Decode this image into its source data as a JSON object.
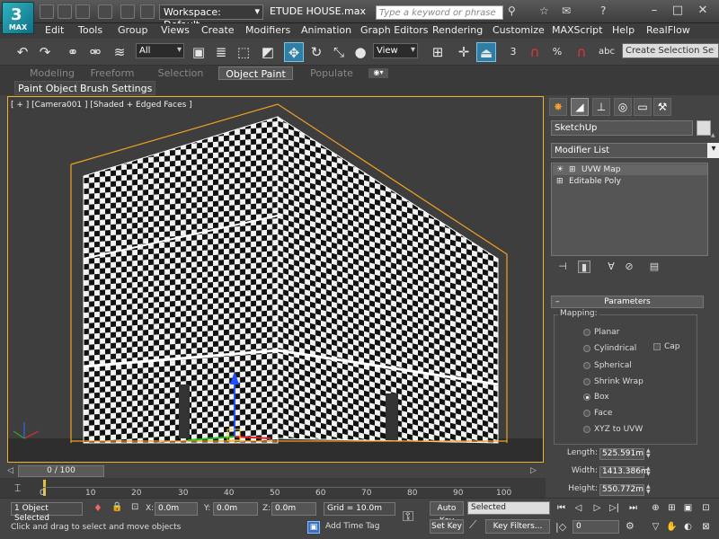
{
  "titlebar": {
    "logo_text": "MAX",
    "workspace": "Workspace: Default",
    "file_title": "ETUDE HOUSE.max",
    "search_placeholder": "Type a keyword or phrase"
  },
  "menu": [
    "Edit",
    "Tools",
    "Group",
    "Views",
    "Create",
    "Modifiers",
    "Animation",
    "Graph Editors",
    "Rendering",
    "Customize",
    "MAXScript",
    "Help",
    "RealFlow"
  ],
  "toolbar": {
    "selection_filter": "All",
    "ref_coord": "View",
    "named_selection_placeholder": "Create Selection Se"
  },
  "ribbon": {
    "tabs": [
      "Modeling",
      "Freeform",
      "Selection",
      "Object Paint",
      "Populate"
    ],
    "active_tab": "Object Paint",
    "subtabs": [
      "Paint Objects",
      "Brush Settings"
    ]
  },
  "viewport": {
    "label": "[ + ] [Camera001 ] [Shaded + Edged Faces ]"
  },
  "command_panel": {
    "object_name": "SketchUp",
    "modifier_list": "Modifier List",
    "stack": [
      "UVW Map",
      "Editable Poly"
    ],
    "rollout_title": "Parameters",
    "mapping_label": "Mapping:",
    "mapping_options": [
      "Planar",
      "Cylindrical",
      "Spherical",
      "Shrink Wrap",
      "Box",
      "Face",
      "XYZ to UVW"
    ],
    "mapping_selected": "Box",
    "cap_label": "Cap",
    "length_label": "Length:",
    "length_value": "525.591m",
    "width_label": "Width:",
    "width_value": "1413.386m",
    "height_label": "Height:",
    "height_value": "550.772m"
  },
  "timeline": {
    "slider": "0 / 100",
    "ticks": [
      "0",
      "10",
      "20",
      "30",
      "40",
      "50",
      "60",
      "70",
      "80",
      "90",
      "100"
    ]
  },
  "status": {
    "selected": "1 Object Selected",
    "prompt": "Click and drag to select and move objects",
    "x_label": "X:",
    "x_value": "0.0m",
    "y_label": "Y:",
    "y_value": "0.0m",
    "z_label": "Z:",
    "z_value": "0.0m",
    "grid": "Grid = 10.0m",
    "add_time_tag": "Add Time Tag",
    "auto_key": "Auto Key",
    "key_mode": "Selected",
    "set_key": "Set Key",
    "key_filters": "Key Filters...",
    "frame": "0"
  }
}
